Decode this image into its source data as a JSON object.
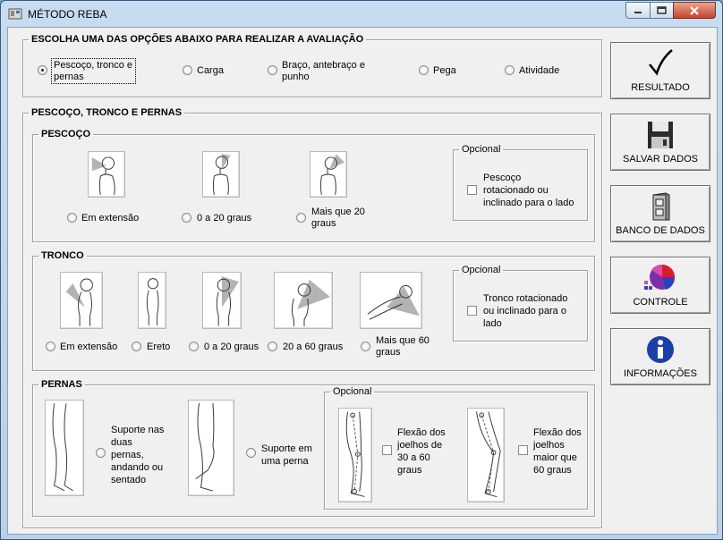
{
  "window": {
    "title": "MÉTODO REBA"
  },
  "choose_group": {
    "legend": "ESCOLHA UMA DAS OPÇÕES ABAIXO PARA REALIZAR A AVALIAÇÃO",
    "options": [
      {
        "label_l1": "Pescoço, tronco e",
        "label_l2": "pernas",
        "selected": true
      },
      {
        "label": "Carga",
        "selected": false
      },
      {
        "label_l1": "Braço, antebraço e",
        "label_l2": "punho",
        "selected": false
      },
      {
        "label": "Pega",
        "selected": false
      },
      {
        "label": "Atividade",
        "selected": false
      }
    ]
  },
  "ntp_group": {
    "legend": "PESCOÇO, TRONCO E PERNAS"
  },
  "neck": {
    "legend": "PESCOÇO",
    "options": [
      {
        "label": "Em extensão"
      },
      {
        "label": "0 a 20 graus"
      },
      {
        "label_l1": "Mais que 20",
        "label_l2": "graus"
      }
    ],
    "optional": {
      "legend": "Opcional",
      "l1": "Pescoço",
      "l2": "rotacionado ou",
      "l3": "inclinado para o lado"
    }
  },
  "trunk": {
    "legend": "TRONCO",
    "options": [
      {
        "label": "Em extensão"
      },
      {
        "label": "Ereto"
      },
      {
        "label": "0 a 20 graus"
      },
      {
        "label": "20 a 60 graus"
      },
      {
        "label_l1": "Mais que 60",
        "label_l2": "graus"
      }
    ],
    "optional": {
      "legend": "Opcional",
      "l1": "Tronco rotacionado",
      "l2": "ou inclinado para o",
      "l3": "lado"
    }
  },
  "legs": {
    "legend": "PERNAS",
    "opt1": {
      "l1": "Suporte nas",
      "l2": "duas",
      "l3": "pernas,",
      "l4": "andando ou",
      "l5": "sentado"
    },
    "opt2": {
      "l1": "Suporte em",
      "l2": "uma perna"
    },
    "optional": {
      "legend": "Opcional",
      "c1": {
        "l1": "Flexão dos",
        "l2": "joelhos de",
        "l3": "30 a 60",
        "l4": "graus"
      },
      "c2": {
        "l1": "Flexão dos",
        "l2": "joelhos",
        "l3": "maior que",
        "l4": "60 graus"
      }
    }
  },
  "sidebar": {
    "resultado": "RESULTADO",
    "salvar": "SALVAR DADOS",
    "banco": "BANCO DE DADOS",
    "controle": "CONTROLE",
    "informacoes": "INFORMAÇÕES"
  },
  "icons": {
    "check": "check-mark-icon",
    "floppy": "floppy-disk-icon",
    "cabinet": "file-cabinet-icon",
    "pie": "pie-chart-icon",
    "info": "info-icon"
  },
  "colors": {
    "info_blue": "#1a3fa8",
    "close_red": "#c5452b",
    "sector_gray": "#b3b3b3"
  }
}
